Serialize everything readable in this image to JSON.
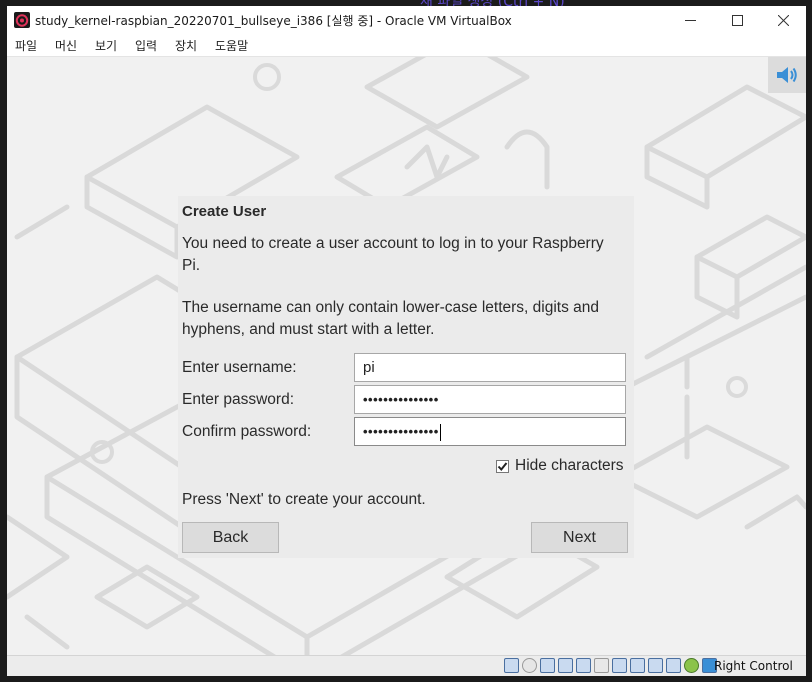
{
  "window": {
    "title": "study_kernel-raspbian_20220701_bullseye_i386 [실행 중] - Oracle VM VirtualBox",
    "outer_hint": "새 파일 생성 (Ctrl + N)"
  },
  "menu": [
    "파일",
    "머신",
    "보기",
    "입력",
    "장치",
    "도움말"
  ],
  "dialog": {
    "title": "Create User",
    "para1": "You need to create a user account to log in to your Raspberry Pi.",
    "para2": "The username can only contain lower-case letters, digits and hyphens, and must start with a letter.",
    "username_label": "Enter username:",
    "username_value": "pi",
    "password_label": "Enter password:",
    "password_value": "•••••••••••••••",
    "confirm_label": "Confirm password:",
    "confirm_value": "•••••••••••••••",
    "hide_label": "Hide characters",
    "hide_checked": true,
    "press_next": "Press 'Next' to create your account.",
    "back_label": "Back",
    "next_label": "Next"
  },
  "statusbar": {
    "host_key": "Right Control"
  },
  "colors": {
    "dialog_bg": "#ebebeb",
    "guest_bg": "#f1f1f1",
    "icon_accent": "#3a8fd6"
  }
}
